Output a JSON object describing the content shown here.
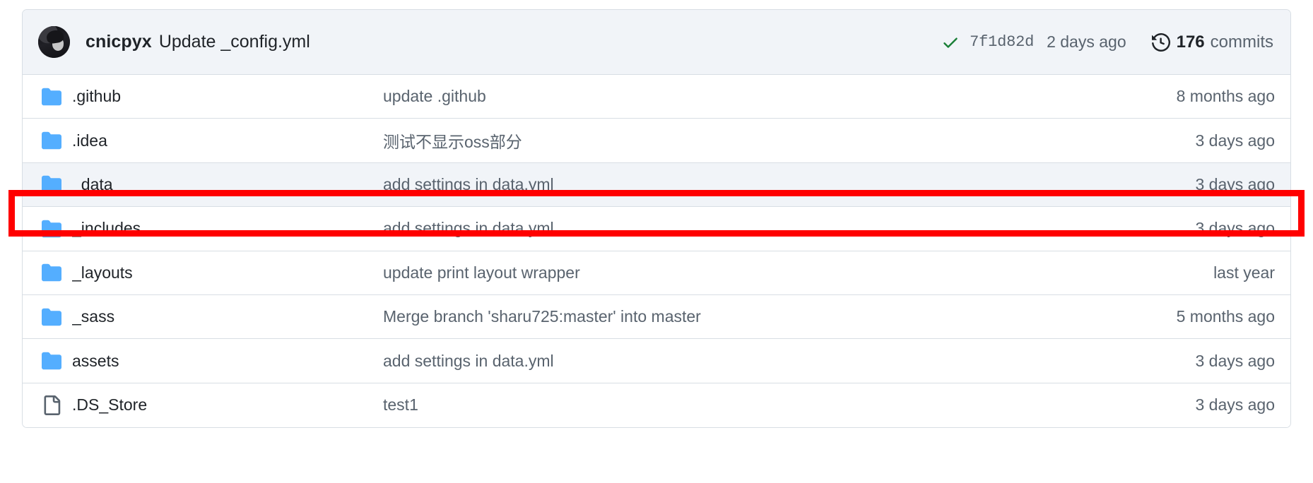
{
  "header": {
    "avatar_name": "user-avatar",
    "author": "cnicpyx",
    "message": "Update _config.yml",
    "status_icon": "check-icon",
    "commit_sha": "7f1d82d",
    "commit_time": "2 days ago",
    "history_icon": "history-icon",
    "commits_count": "176",
    "commits_label": "commits"
  },
  "colors": {
    "folder_icon": "#54aeff",
    "check_green": "#1a7f37",
    "annotation_red": "#ff0000",
    "row_highlight_bg": "#f1f4f8",
    "header_bg": "#f1f4f8",
    "border": "#d8dee4",
    "text_primary": "#1f2328",
    "text_muted": "#59636e"
  },
  "files": [
    {
      "icon": "folder-icon",
      "type": "folder",
      "name": ".github",
      "message": "update .github",
      "date": "8 months ago",
      "highlighted": false
    },
    {
      "icon": "folder-icon",
      "type": "folder",
      "name": ".idea",
      "message": "测试不显示oss部分",
      "date": "3 days ago",
      "highlighted": false
    },
    {
      "icon": "folder-icon",
      "type": "folder",
      "name": "_data",
      "message": "add settings in data.yml",
      "date": "3 days ago",
      "highlighted": true
    },
    {
      "icon": "folder-icon",
      "type": "folder",
      "name": "_includes",
      "message": "add settings in data.yml",
      "date": "3 days ago",
      "highlighted": false
    },
    {
      "icon": "folder-icon",
      "type": "folder",
      "name": "_layouts",
      "message": "update print layout wrapper",
      "date": "last year",
      "highlighted": false
    },
    {
      "icon": "folder-icon",
      "type": "folder",
      "name": "_sass",
      "message": "Merge branch 'sharu725:master' into master",
      "date": "5 months ago",
      "highlighted": false
    },
    {
      "icon": "folder-icon",
      "type": "folder",
      "name": "assets",
      "message": "add settings in data.yml",
      "date": "3 days ago",
      "highlighted": false
    },
    {
      "icon": "file-icon",
      "type": "file",
      "name": ".DS_Store",
      "message": "test1",
      "date": "3 days ago",
      "highlighted": false
    }
  ]
}
